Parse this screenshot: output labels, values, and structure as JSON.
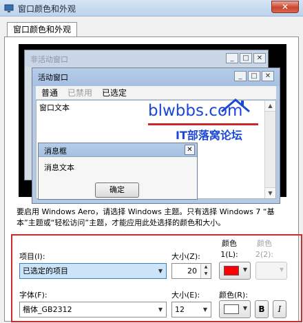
{
  "window": {
    "title": "窗口颜色和外观",
    "close_label": "✕"
  },
  "tabs": [
    {
      "label": "窗口颜色和外观"
    }
  ],
  "preview": {
    "inactive_title": "非活动窗口",
    "active_title": "活动窗口",
    "caption_buttons": {
      "minimize": "_",
      "maximize": "□",
      "close": "✕"
    },
    "menu": {
      "normal": "普通",
      "disabled": "已禁用",
      "selected": "已选定"
    },
    "window_text": "窗口文本",
    "message_box": {
      "title": "消息框",
      "text": "消息文本",
      "ok": "确定"
    }
  },
  "watermark": {
    "logo": "blwbbs.com",
    "subtitle": "IT部落窝论坛"
  },
  "description": "要启用 Windows Aero，请选择 Windows 主题。只有选择 Windows 7 “基本”主题或“轻松访问”主题，才能应用此处选择的颜色和大小。",
  "settings": {
    "item_label": "项目(I):",
    "item_value": "已选定的项目",
    "size_label": "大小(Z):",
    "size_value": "20",
    "color1_label": "颜色 1(L):",
    "color1_value": "#ff0000",
    "color2_label": "颜色 2(2):",
    "font_label": "字体(F):",
    "font_value": "楷体_GB2312",
    "font_size_label": "大小(E):",
    "font_size_value": "12",
    "font_color_label": "颜色(R):",
    "font_color_value": "#ffffff",
    "bold_label": "B",
    "italic_label": "I"
  }
}
